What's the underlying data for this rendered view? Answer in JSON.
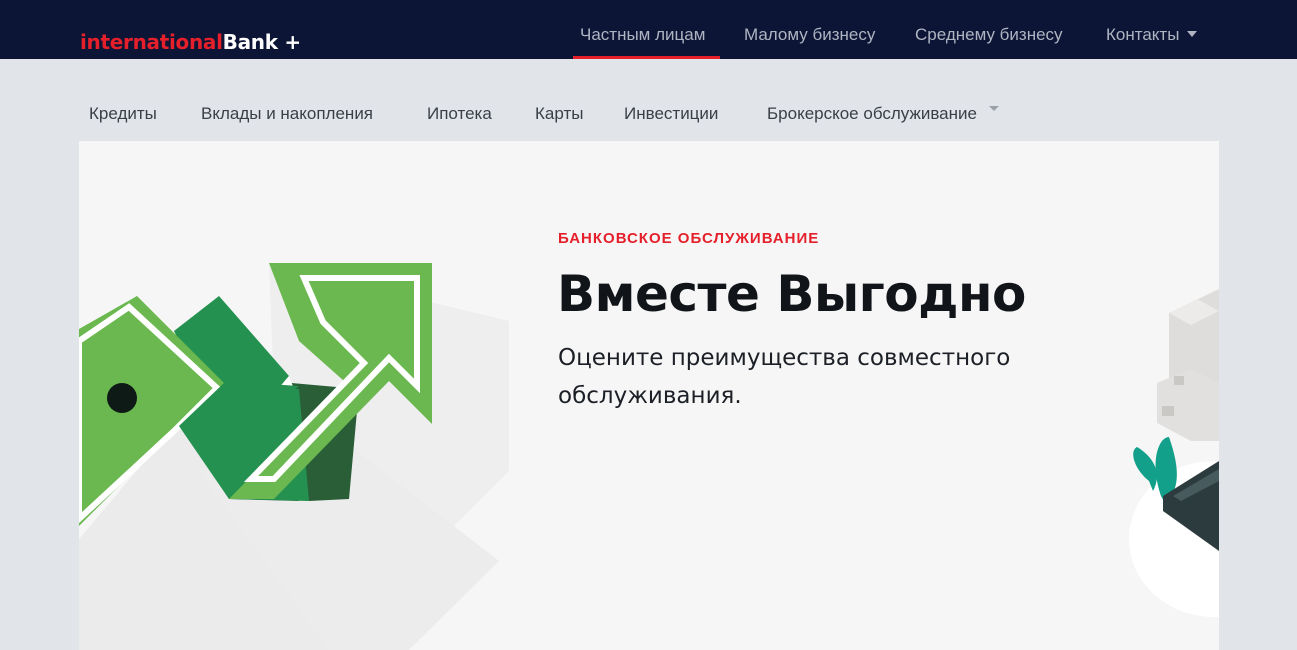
{
  "brand": {
    "part1": "international",
    "part2": "Bank +"
  },
  "top_nav": [
    {
      "label": "Частным лицам",
      "active": true
    },
    {
      "label": "Малому бизнесу"
    },
    {
      "label": "Среднему бизнесу"
    },
    {
      "label": "Контакты",
      "has_dropdown": true
    }
  ],
  "sub_nav": [
    {
      "label": "Кредиты"
    },
    {
      "label": "Вклады и накопления"
    },
    {
      "label": "Ипотека"
    },
    {
      "label": "Карты"
    },
    {
      "label": "Инвестиции"
    },
    {
      "label": "Брокерское обслуживание",
      "has_dropdown": true
    }
  ],
  "hero": {
    "eyebrow": "БАНКОВСКОЕ ОБСЛУЖИВАНИЕ",
    "title": "Вместе Выгодно",
    "subtitle": "Оцените преимущества совместного обслуживания."
  },
  "colors": {
    "topbar_bg": "#0c1535",
    "accent_red": "#e5202b",
    "page_bg": "#e1e4e9",
    "hero_bg": "#f6f6f6",
    "green_light": "#6ab84f",
    "green_mid": "#249150",
    "green_dark": "#2a5e37"
  },
  "icons": [
    "arrow-up-illustration",
    "dropdown-caret-icon"
  ]
}
